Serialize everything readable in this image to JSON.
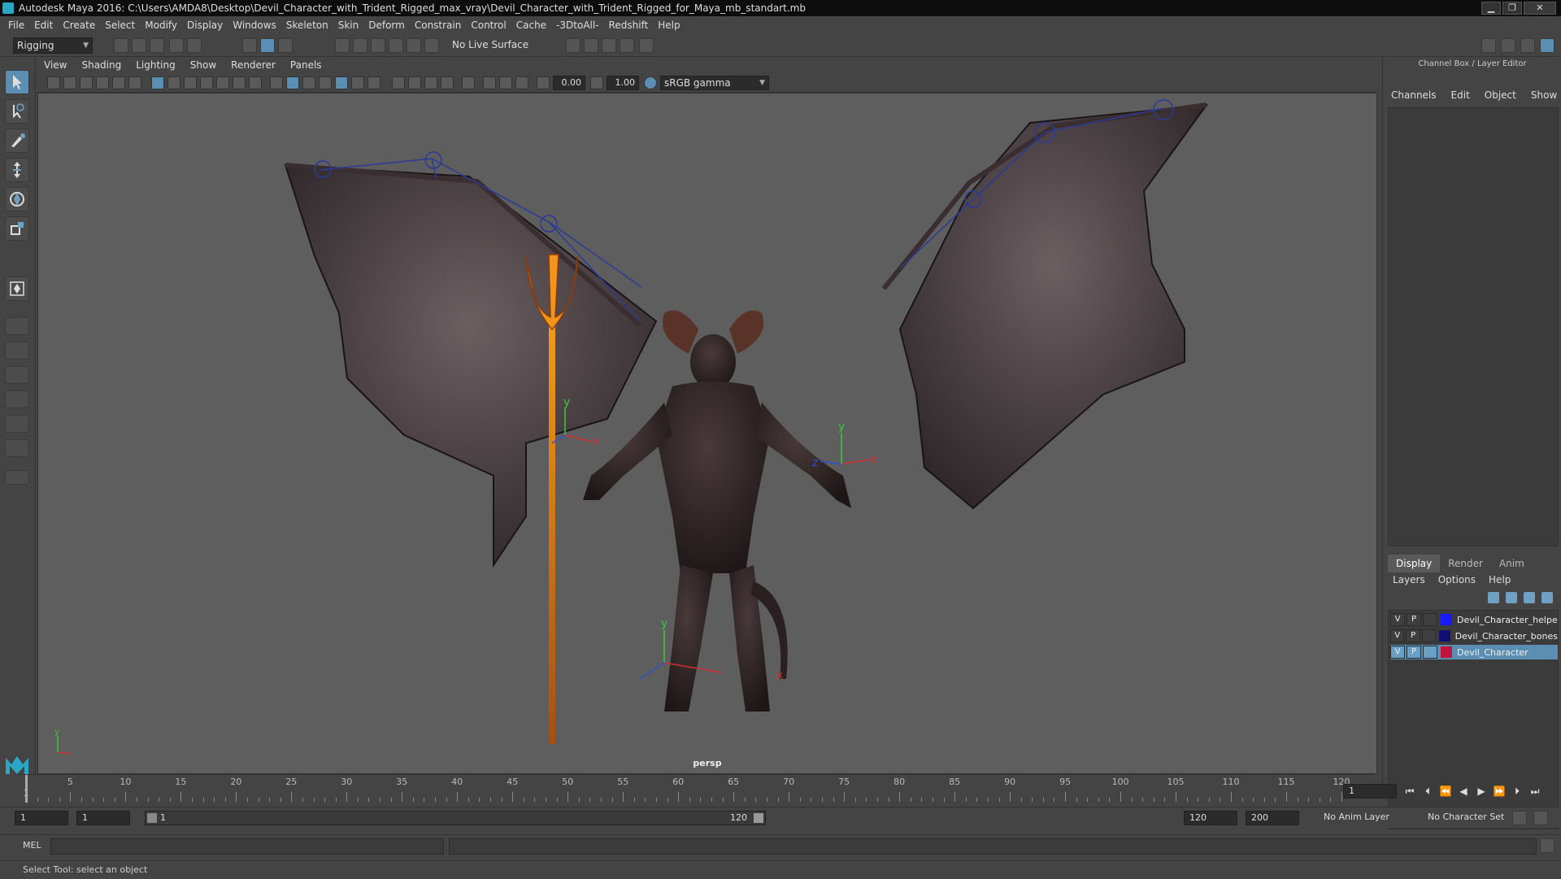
{
  "window": {
    "title": "Autodesk Maya 2016: C:\\Users\\AMDA8\\Desktop\\Devil_Character_with_Trident_Rigged_max_vray\\Devil_Character_with_Trident_Rigged_for_Maya_mb_standart.mb",
    "min": "▁",
    "max": "❐",
    "close": "✕"
  },
  "menubar": [
    "File",
    "Edit",
    "Create",
    "Select",
    "Modify",
    "Display",
    "Windows",
    "Skeleton",
    "Skin",
    "Deform",
    "Constrain",
    "Control",
    "Cache",
    "-3DtoAll-",
    "Redshift",
    "Help"
  ],
  "toolbar": {
    "mode": "Rigging",
    "live_surface": "No Live Surface"
  },
  "panel_menu": [
    "View",
    "Shading",
    "Lighting",
    "Show",
    "Renderer",
    "Panels"
  ],
  "viewport_toolbar": {
    "exposure": "0.00",
    "gamma": "1.00",
    "color_space": "sRGB gamma"
  },
  "viewport": {
    "camera": "persp",
    "axis_y": "y",
    "axis_x": "x",
    "axis_z": "z"
  },
  "channel_box": {
    "title": "Channel Box / Layer Editor",
    "menu": [
      "Channels",
      "Edit",
      "Object",
      "Show"
    ]
  },
  "layer_editor": {
    "tabs": [
      "Display",
      "Render",
      "Anim"
    ],
    "active_tab": "Display",
    "menu": [
      "Layers",
      "Options",
      "Help"
    ],
    "layers": [
      {
        "v": "V",
        "p": "P",
        "name": "Devil_Character_helpe",
        "color": "#1a1aff",
        "selected": false
      },
      {
        "v": "V",
        "p": "P",
        "name": "Devil_Character_bones",
        "color": "#101070",
        "selected": false
      },
      {
        "v": "V",
        "p": "P",
        "name": "Devil_Character",
        "color": "#c0143c",
        "selected": true
      }
    ]
  },
  "timeline": {
    "ticks": [
      "1",
      "5",
      "10",
      "15",
      "20",
      "25",
      "30",
      "35",
      "40",
      "45",
      "50",
      "55",
      "60",
      "65",
      "70",
      "75",
      "80",
      "85",
      "90",
      "95",
      "100",
      "105",
      "110",
      "115",
      "120"
    ],
    "current_frame": "1"
  },
  "range": {
    "start": "1",
    "playback_start": "1",
    "slider_left": "1",
    "slider_right": "120",
    "playback_end": "120",
    "end": "200",
    "anim_layer": "No Anim Layer",
    "char_set": "No Character Set"
  },
  "mel": {
    "label": "MEL"
  },
  "status": "Select Tool: select an object",
  "colors": {
    "accent": "#5a8fb3",
    "viewport_bg": "#5e5e5e"
  }
}
